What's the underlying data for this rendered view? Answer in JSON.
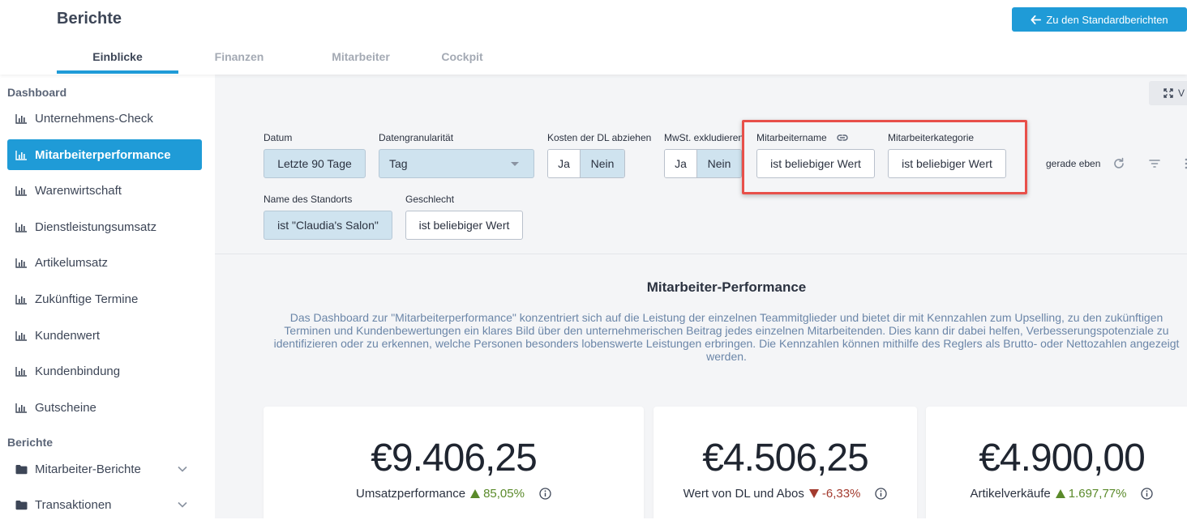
{
  "header": {
    "title": "Berichte",
    "standard_button": "Zu den Standardberichten",
    "tabs": [
      {
        "label": "Einblicke",
        "active": true
      },
      {
        "label": "Finanzen",
        "active": false
      },
      {
        "label": "Mitarbeiter",
        "active": false
      },
      {
        "label": "Cockpit",
        "active": false
      }
    ]
  },
  "sidebar": {
    "section_dashboard": "Dashboard",
    "dashboard_items": [
      {
        "label": "Unternehmens-Check",
        "icon": "bar-chart-icon"
      },
      {
        "label": "Mitarbeiterperformance",
        "icon": "bar-chart-icon",
        "active": true
      },
      {
        "label": "Warenwirtschaft",
        "icon": "bar-chart-icon"
      },
      {
        "label": "Dienstleistungsumsatz",
        "icon": "bar-chart-icon"
      },
      {
        "label": "Artikelumsatz",
        "icon": "bar-chart-icon"
      },
      {
        "label": "Zukünftige Termine",
        "icon": "bar-chart-icon"
      },
      {
        "label": "Kundenwert",
        "icon": "bar-chart-icon"
      },
      {
        "label": "Kundenbindung",
        "icon": "bar-chart-icon"
      },
      {
        "label": "Gutscheine",
        "icon": "bar-chart-icon"
      }
    ],
    "section_berichte": "Berichte",
    "report_items": [
      {
        "label": "Mitarbeiter-Berichte",
        "icon": "folder-icon"
      },
      {
        "label": "Transaktionen",
        "icon": "folder-icon"
      }
    ]
  },
  "filters": {
    "corner_button": "V",
    "datum": {
      "label": "Datum",
      "value": "Letzte 90 Tage"
    },
    "granularitaet": {
      "label": "Datengranularität",
      "value": "Tag"
    },
    "kosten": {
      "label": "Kosten der DL abziehen",
      "ja": "Ja",
      "nein": "Nein"
    },
    "mwst": {
      "label": "MwSt. exkludieren",
      "ja": "Ja",
      "nein": "Nein"
    },
    "mitarbeitername": {
      "label": "Mitarbeitername",
      "value": "ist beliebiger Wert"
    },
    "mitarbeiterkategorie": {
      "label": "Mitarbeiterkategorie",
      "value": "ist beliebiger Wert"
    },
    "standort": {
      "label": "Name des Standorts",
      "value": "ist \"Claudia's Salon\""
    },
    "geschlecht": {
      "label": "Geschlecht",
      "value": "ist beliebiger Wert"
    },
    "status": "gerade eben"
  },
  "dashboard": {
    "title": "Mitarbeiter-Performance",
    "description": "Das Dashboard zur \"Mitarbeiterperformance\" konzentriert sich auf die Leistung der einzelnen Teammitglieder und bietet dir mit Kennzahlen zum Upselling, zu den zukünftigen Terminen und Kundenbewertungen ein klares Bild über den unternehmerischen Beitrag jedes einzelnen Mitarbeitenden. Dies kann dir dabei helfen, Verbesserungspotenziale zu identifizieren oder zu erkennen, welche Personen besonders lobenswerte Leistungen erbringen. Die Kennzahlen können mithilfe des Reglers als Brutto- oder Nettozahlen angezeigt werden."
  },
  "cards": [
    {
      "value": "€9.406,25",
      "label": "Umsatzperformance",
      "trend": "85,05%",
      "direction": "up"
    },
    {
      "value": "€4.506,25",
      "label": "Wert von DL und Abos",
      "trend": "-6,33%",
      "direction": "down"
    },
    {
      "value": "€4.900,00",
      "label": "Artikelverkäufe",
      "trend": "1.697,77%",
      "direction": "up"
    }
  ],
  "colors": {
    "accent": "#1f9bd7",
    "highlight": "#e8504a",
    "trend_up": "#5a8a2a",
    "trend_down": "#a33b2f"
  }
}
